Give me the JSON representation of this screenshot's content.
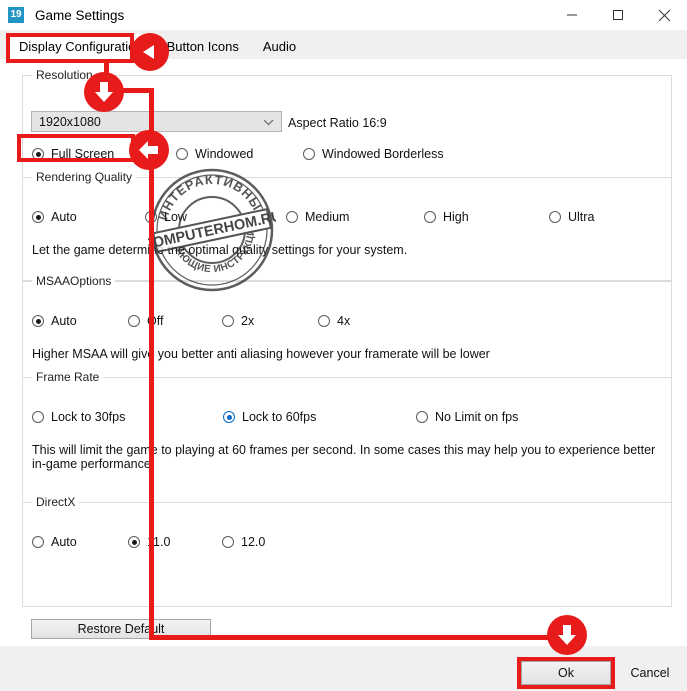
{
  "window": {
    "title": "Game Settings",
    "icon_label": "19",
    "controls": {
      "minimize": "minimize-icon",
      "maximize": "maximize-icon",
      "close": "close-icon"
    }
  },
  "tabs": [
    {
      "label": "Display Configuration",
      "active": true
    },
    {
      "label": "Button Icons",
      "active": false
    },
    {
      "label": "Audio",
      "active": false
    }
  ],
  "sections": {
    "resolution": {
      "title": "Resolution",
      "selected_resolution": "1920x1080",
      "aspect_ratio": "Aspect Ratio 16:9",
      "modes": [
        {
          "label": "Full Screen",
          "checked": true
        },
        {
          "label": "Windowed",
          "checked": false
        },
        {
          "label": "Windowed Borderless",
          "checked": false
        }
      ]
    },
    "rendering_quality": {
      "title": "Rendering Quality",
      "options": [
        {
          "label": "Auto",
          "checked": true
        },
        {
          "label": "Low",
          "checked": false
        },
        {
          "label": "Medium",
          "checked": false
        },
        {
          "label": "High",
          "checked": false
        },
        {
          "label": "Ultra",
          "checked": false
        }
      ],
      "hint": "Let the game determine the optimal quality settings for your system."
    },
    "msaa": {
      "title": "MSAAOptions",
      "options": [
        {
          "label": "Auto",
          "checked": true
        },
        {
          "label": "Off",
          "checked": false
        },
        {
          "label": "2x",
          "checked": false
        },
        {
          "label": "4x",
          "checked": false
        }
      ],
      "hint": "Higher MSAA will give you better anti aliasing however your framerate will be lower"
    },
    "frame_rate": {
      "title": "Frame Rate",
      "options": [
        {
          "label": "Lock  to 30fps",
          "checked": false
        },
        {
          "label": "Lock to 60fps",
          "checked": true
        },
        {
          "label": "No Limit on fps",
          "checked": false
        }
      ],
      "hint": "This will limit the game to playing at 60 frames per second. In some cases this may help you to experience better in-game performance."
    },
    "directx": {
      "title": "DirectX",
      "options": [
        {
          "label": "Auto",
          "checked": false
        },
        {
          "label": "11.0",
          "checked": true
        },
        {
          "label": "12.0",
          "checked": false
        }
      ]
    }
  },
  "buttons": {
    "restore_default": "Restore Default",
    "ok": "Ok",
    "cancel": "Cancel"
  },
  "watermark": {
    "outer_top": "ИНТЕРАКТИВНЫЕ",
    "outer_bottom": "ОБУЧАЮЩИЕ ИНСТРУКЦИИ",
    "banner": "COMPUTERHOM.RU"
  },
  "annotations": {
    "accent_color": "#e81b1b",
    "highlights": [
      "Display Configuration tab",
      "Full Screen radio",
      "Ok button"
    ],
    "arrows": [
      "down-arrow-to-resolution",
      "left-arrow-to-full-screen",
      "down-arrow-to-ok"
    ]
  }
}
